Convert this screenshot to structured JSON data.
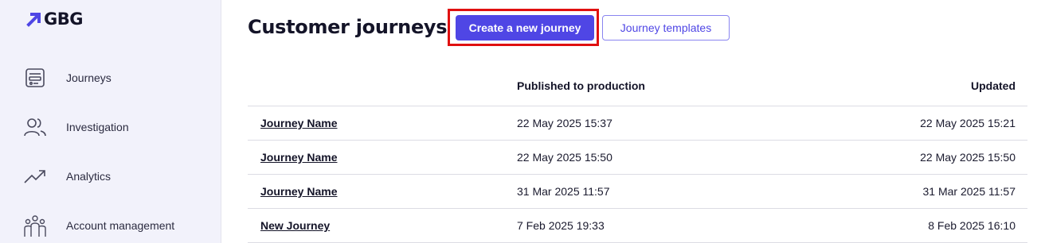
{
  "brand": {
    "logo_text": "GBG",
    "accent": "#4f46e5",
    "highlight": "#e01010"
  },
  "sidebar": {
    "items": [
      {
        "label": "Journeys",
        "icon": "journeys-icon"
      },
      {
        "label": "Investigation",
        "icon": "users-icon"
      },
      {
        "label": "Analytics",
        "icon": "trend-icon"
      },
      {
        "label": "Account management",
        "icon": "team-icon"
      }
    ]
  },
  "header": {
    "title": "Customer journeys",
    "create_label": "Create a new journey",
    "templates_label": "Journey templates"
  },
  "table": {
    "columns": {
      "name": "",
      "published": "Published to production",
      "updated": "Updated"
    },
    "rows": [
      {
        "name": "Journey Name",
        "published": "22 May 2025 15:37",
        "updated": "22 May 2025 15:21"
      },
      {
        "name": "Journey Name",
        "published": "22 May 2025 15:50",
        "updated": "22 May 2025 15:50"
      },
      {
        "name": "Journey Name",
        "published": "31 Mar 2025 11:57",
        "updated": "31 Mar 2025 11:57"
      },
      {
        "name": "New Journey",
        "published": "7 Feb 2025 19:33",
        "updated": "8 Feb 2025 16:10"
      }
    ]
  }
}
